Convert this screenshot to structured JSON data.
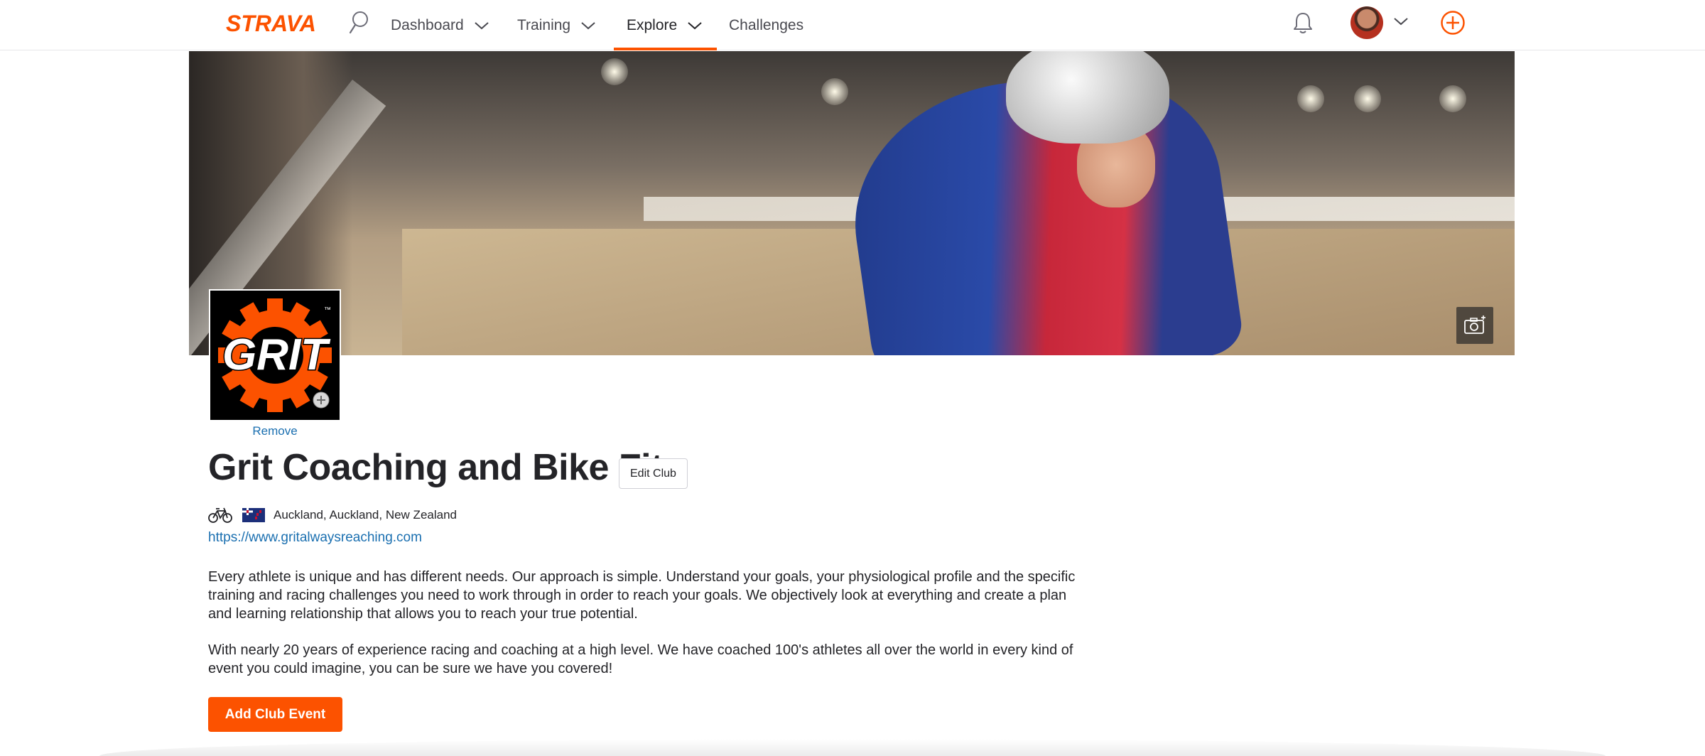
{
  "header": {
    "brand": "STRAVA",
    "brand_color": "#fc5200",
    "search_icon": "search-icon",
    "nav": {
      "dashboard": "Dashboard",
      "training": "Training",
      "explore": "Explore",
      "challenges": "Challenges"
    },
    "active_nav": "Explore",
    "notifications_icon": "bell-icon",
    "create_icon": "plus-circle-icon"
  },
  "club": {
    "remove_label": "Remove",
    "name": "Grit Coaching and Bike Fit",
    "edit_label": "Edit Club",
    "sport_icon": "bike-icon",
    "flag_icon": "new-zealand-flag-icon",
    "location": "Auckland, Auckland, New Zealand",
    "website": "https://www.gritalwaysreaching.com",
    "description": [
      "Every athlete is unique and has different needs. Our approach is simple. Understand your goals, your physiological profile and the specific training and racing challenges you need to work through in order to reach your goals. We objectively look at everything and create a plan and learning relationship that allows you to reach your true potential.",
      "With nearly 20 years of experience racing and coaching at a high level. We have coached 100's athletes all over the world in every kind of event you could imagine, you can be sure we have you covered!"
    ],
    "add_event_label": "Add Club Event",
    "logo_text": "GRIT",
    "logo_tm": "™"
  }
}
